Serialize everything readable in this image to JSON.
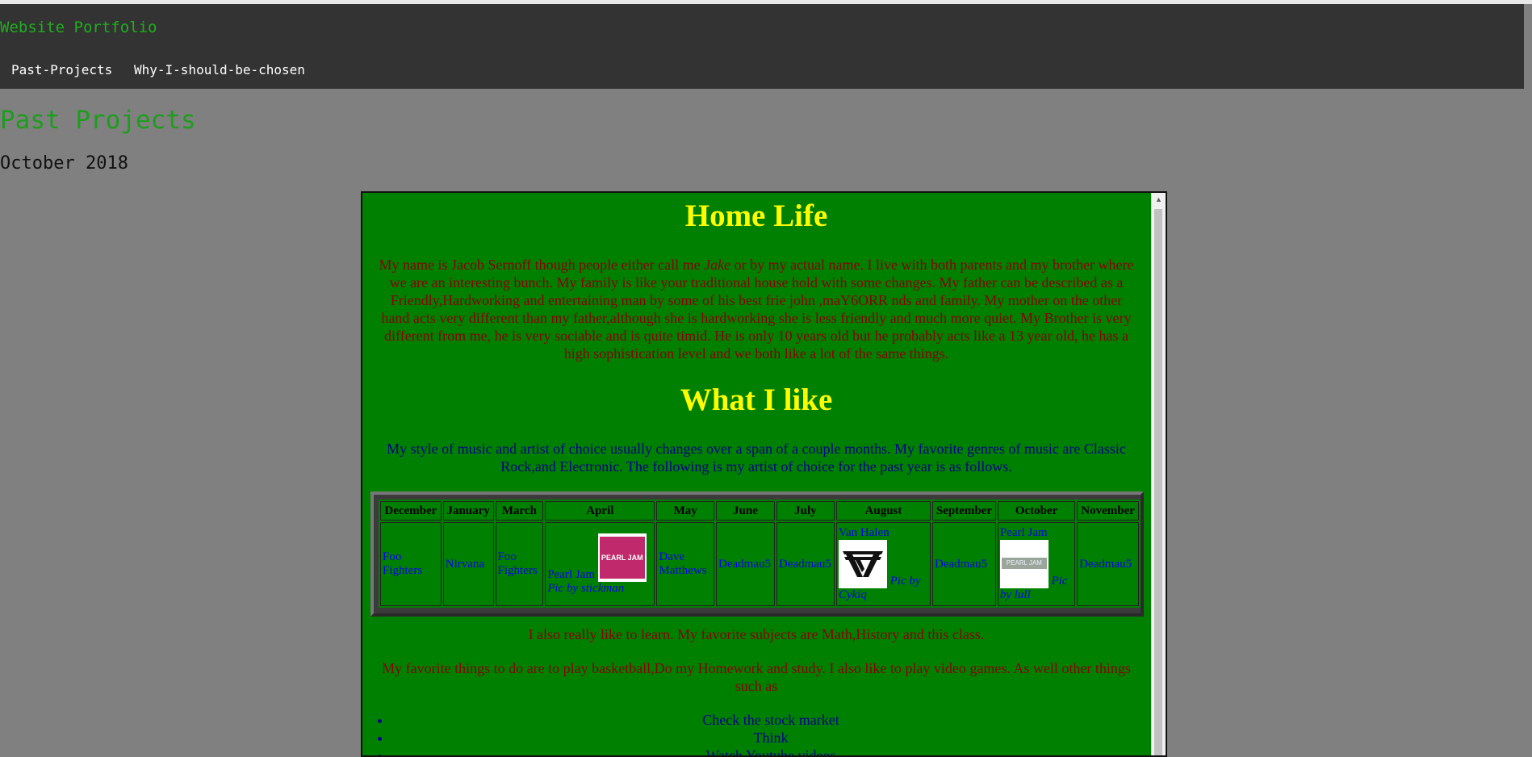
{
  "nav": {
    "site_title": "Website Portfolio",
    "links": [
      "Past-Projects",
      "Why-I-should-be-chosen"
    ]
  },
  "page": {
    "title": "Past Projects",
    "date": "October 2018"
  },
  "frame": {
    "home_life": {
      "heading": "Home Life",
      "paragraph_before": "My name is Jacob Sernoff though people either call me ",
      "nickname": "Jake",
      "paragraph_after": " or by my actual name. I live with both parents and my brother where we are an interesting bunch. My family is like your traditional house hold with some changes. My father can be described as a Friendly,Hardworking and entertaining man by some of his best frie john ,maY6ORR nds and family. My mother on the other hand acts very different than my father,although she is hardworking she is less friendly and much more quiet. My Brother is very different from me, he is very sociable and is quite timid. He is only 10 years old but he probably acts like a 13 year old, he has a high sophistication level and we both like a lot of the same things."
    },
    "what_i_like": {
      "heading": "What I like",
      "paragraph": "My style of music and artist of choice usually changes over a span of a couple months. My favorite genres of music are Classic Rock,and Electronic. The following is my artist of choice for the past year is as follows."
    },
    "table": {
      "headers": [
        "December",
        "January",
        "March",
        "April",
        "May",
        "June",
        "July",
        "August",
        "September",
        "October",
        "November"
      ],
      "cells": {
        "december": "Foo Fighters",
        "january": "Nirvana",
        "march": "Foo Fighters",
        "april_artist": "Pearl Jam",
        "april_caption": "Pic by stickman",
        "april_logo_text": "PEARL JAM",
        "may": "Dave Matthews",
        "june": "Deadmau5",
        "july": "Deadmau5",
        "august_artist": "Van Halen",
        "august_caption": "Pic by Cykiq",
        "september": "Deadmau5",
        "october_artist": "Pearl Jam",
        "october_caption": "Pic by lull",
        "october_logo_text": "PEARL JAM",
        "november": "Deadmau5"
      }
    },
    "learn_paragraph": "I also really like to learn. My favorite subjects are Math,History and this class.",
    "favorite_paragraph": "My favorite things to do are to play basketball,Do my Homework and study. I also like to play video games. As well other things such as",
    "list": [
      "Check the stock market",
      "Think",
      "Watch Youtube videos"
    ]
  }
}
